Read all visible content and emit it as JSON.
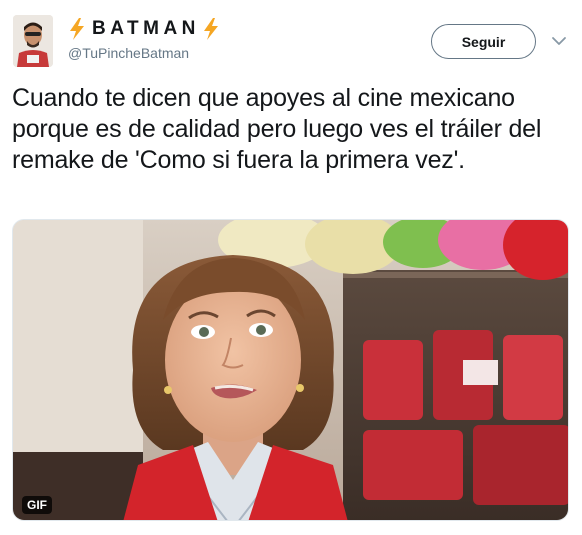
{
  "user": {
    "display_name": "BATMAN",
    "handle": "@TuPincheBatman",
    "name_emoji": "high-voltage-emoji",
    "avatar": "avatar"
  },
  "actions": {
    "follow_label": "Seguir",
    "menu_icon": "chevron-down-icon"
  },
  "tweet": {
    "text": "Cuando te dicen que apoyes al cine mexicano porque es de calidad pero luego ves el tráiler del remake de 'Como si fuera la primera vez'."
  },
  "media": {
    "type_badge": "GIF"
  },
  "colors": {
    "text": "#14171a",
    "secondary": "#657786",
    "bolt": "#f5a623",
    "vest": "#d3242b"
  }
}
